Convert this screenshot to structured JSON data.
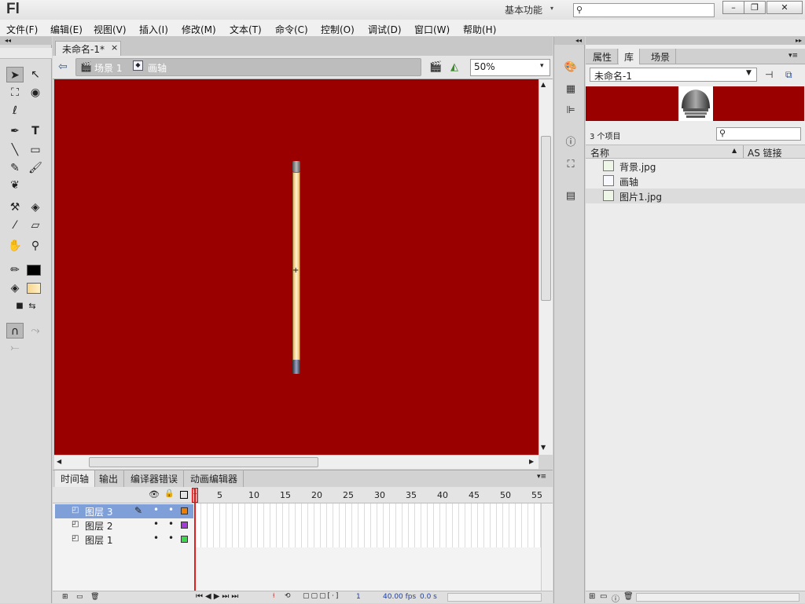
{
  "app": {
    "logo": "Fl",
    "workspace": "基本功能",
    "workspace_arrow": "▾"
  },
  "window_buttons": {
    "minimize": "–",
    "restore": "❐",
    "close": "✕"
  },
  "menu": [
    "文件(F)",
    "编辑(E)",
    "视图(V)",
    "插入(I)",
    "修改(M)",
    "文本(T)",
    "命令(C)",
    "控制(O)",
    "调试(D)",
    "窗口(W)",
    "帮助(H)"
  ],
  "document": {
    "tab_title": "未命名-1*",
    "tab_close": "×",
    "breadcrumb": {
      "scene": "场景 1",
      "symbol": "画轴"
    },
    "zoom": "50%",
    "zoom_arrow": "▾"
  },
  "stage": {
    "background": "#9a0000"
  },
  "timeline": {
    "tabs": [
      "时间轴",
      "输出",
      "编译器错误",
      "动画编辑器"
    ],
    "frame_numbers": [
      "1",
      "5",
      "10",
      "15",
      "20",
      "25",
      "30",
      "35",
      "40",
      "45",
      "50",
      "55"
    ],
    "layers": [
      {
        "name": "图层 3",
        "color": "#f07d00",
        "selected": true
      },
      {
        "name": "图层 2",
        "color": "#a43bd8",
        "selected": false
      },
      {
        "name": "图层 1",
        "color": "#3bd84a",
        "selected": false
      }
    ],
    "footer": {
      "current_frame": "1",
      "fps": "40.00 fps",
      "time": "0.0 s"
    }
  },
  "right_panel": {
    "tabs": [
      "属性",
      "库",
      "场景"
    ],
    "active_tab": "库",
    "library_select": "未命名-1",
    "item_count": "3 个项目",
    "columns": {
      "name": "名称",
      "linkage": "AS 链接"
    },
    "items": [
      {
        "name": "背景.jpg",
        "type": "bitmap"
      },
      {
        "name": "画轴",
        "type": "symbol"
      },
      {
        "name": "图片1.jpg",
        "type": "bitmap"
      }
    ]
  }
}
